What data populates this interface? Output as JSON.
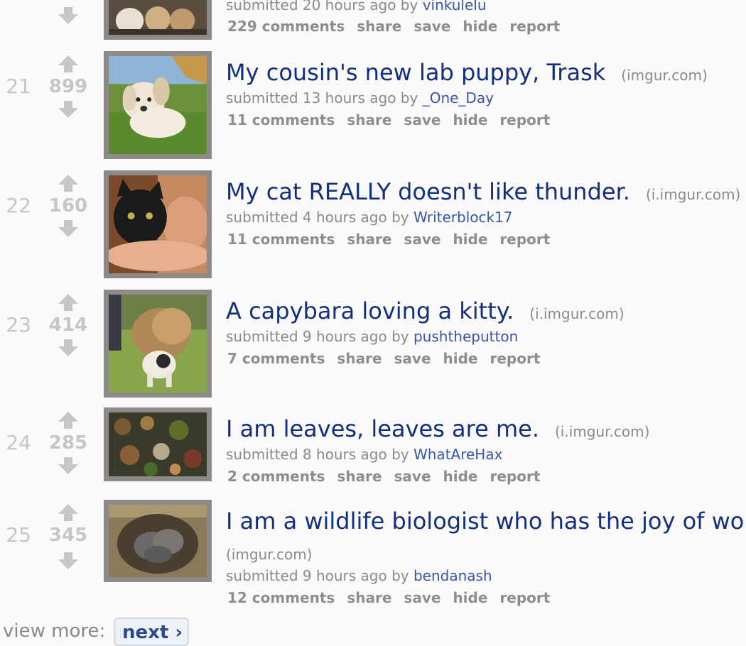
{
  "previous_post": {
    "tagline_prefix": "submitted 20 hours ago by ",
    "author": "vinkulelu",
    "buttons": [
      "229 comments",
      "share",
      "save",
      "hide",
      "report"
    ]
  },
  "posts": [
    {
      "rank": "21",
      "score": "899",
      "title": "My cousin's new lab puppy, Trask",
      "domain": "(imgur.com)",
      "tagline_prefix": "submitted 13 hours ago by ",
      "author": "_One_Day",
      "buttons": [
        "11 comments",
        "share",
        "save",
        "hide",
        "report"
      ]
    },
    {
      "rank": "22",
      "score": "160",
      "title": "My cat REALLY doesn't like thunder.",
      "domain": "(i.imgur.com)",
      "tagline_prefix": "submitted 4 hours ago by ",
      "author": "Writerblock17",
      "buttons": [
        "11 comments",
        "share",
        "save",
        "hide",
        "report"
      ]
    },
    {
      "rank": "23",
      "score": "414",
      "title": "A capybara loving a kitty.",
      "domain": "(i.imgur.com)",
      "tagline_prefix": "submitted 9 hours ago by ",
      "author": "pushtheputton",
      "buttons": [
        "7 comments",
        "share",
        "save",
        "hide",
        "report"
      ]
    },
    {
      "rank": "24",
      "score": "285",
      "title": "I am leaves, leaves are me.",
      "domain": "(i.imgur.com)",
      "tagline_prefix": "submitted 8 hours ago by ",
      "author": "WhatAreHax",
      "buttons": [
        "2 comments",
        "share",
        "save",
        "hide",
        "report"
      ]
    },
    {
      "rank": "25",
      "score": "345",
      "title": "I am a wildlife biologist who has the joy of wo",
      "domain": "(imgur.com)",
      "tagline_prefix": "submitted 9 hours ago by ",
      "author": "bendanash",
      "buttons": [
        "12 comments",
        "share",
        "save",
        "hide",
        "report"
      ]
    }
  ],
  "footer": {
    "view_more": "view more:",
    "next": "next ›"
  },
  "icons": {
    "upvote": "up-arrow-icon",
    "downvote": "down-arrow-icon"
  },
  "colors": {
    "title": "#10307f",
    "author": "#3656a8",
    "muted": "#8a8a8a",
    "background": "#fbf9f9"
  }
}
